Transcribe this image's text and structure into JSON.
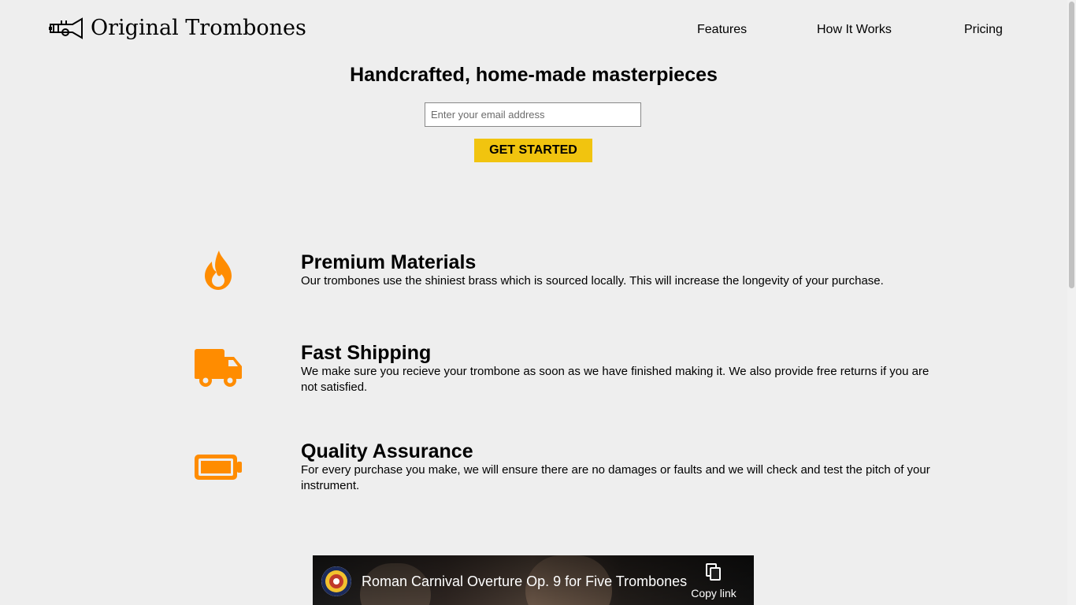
{
  "brand": {
    "name": "Original Trombones",
    "logo_icon": "trumpet-logo"
  },
  "nav": {
    "items": [
      {
        "label": "Features"
      },
      {
        "label": "How It Works"
      },
      {
        "label": "Pricing"
      }
    ]
  },
  "hero": {
    "title": "Handcrafted, home-made masterpieces",
    "email_placeholder": "Enter your email address",
    "email_value": "",
    "cta_label": "GET STARTED"
  },
  "features": [
    {
      "icon": "fire-icon",
      "title": "Premium Materials",
      "description": "Our trombones use the shiniest brass which is sourced locally. This will increase the longevity of your purchase."
    },
    {
      "icon": "truck-icon",
      "title": "Fast Shipping",
      "description": "We make sure you recieve your trombone as soon as we have finished making it. We also provide free returns if you are not satisfied."
    },
    {
      "icon": "battery-full-icon",
      "title": "Quality Assurance",
      "description": "For every purchase you make, we will ensure there are no damages or faults and we will check and test the pitch of your instrument."
    }
  ],
  "video": {
    "title": "Roman Carnival Overture Op. 9 for Five Trombones",
    "copy_label": "Copy link",
    "channel_icon": "channel-avatar",
    "copy_icon": "copy-icon"
  },
  "colors": {
    "background": "#eeeeee",
    "accent": "#f1c40f",
    "icon_orange": "#ff8c00"
  }
}
